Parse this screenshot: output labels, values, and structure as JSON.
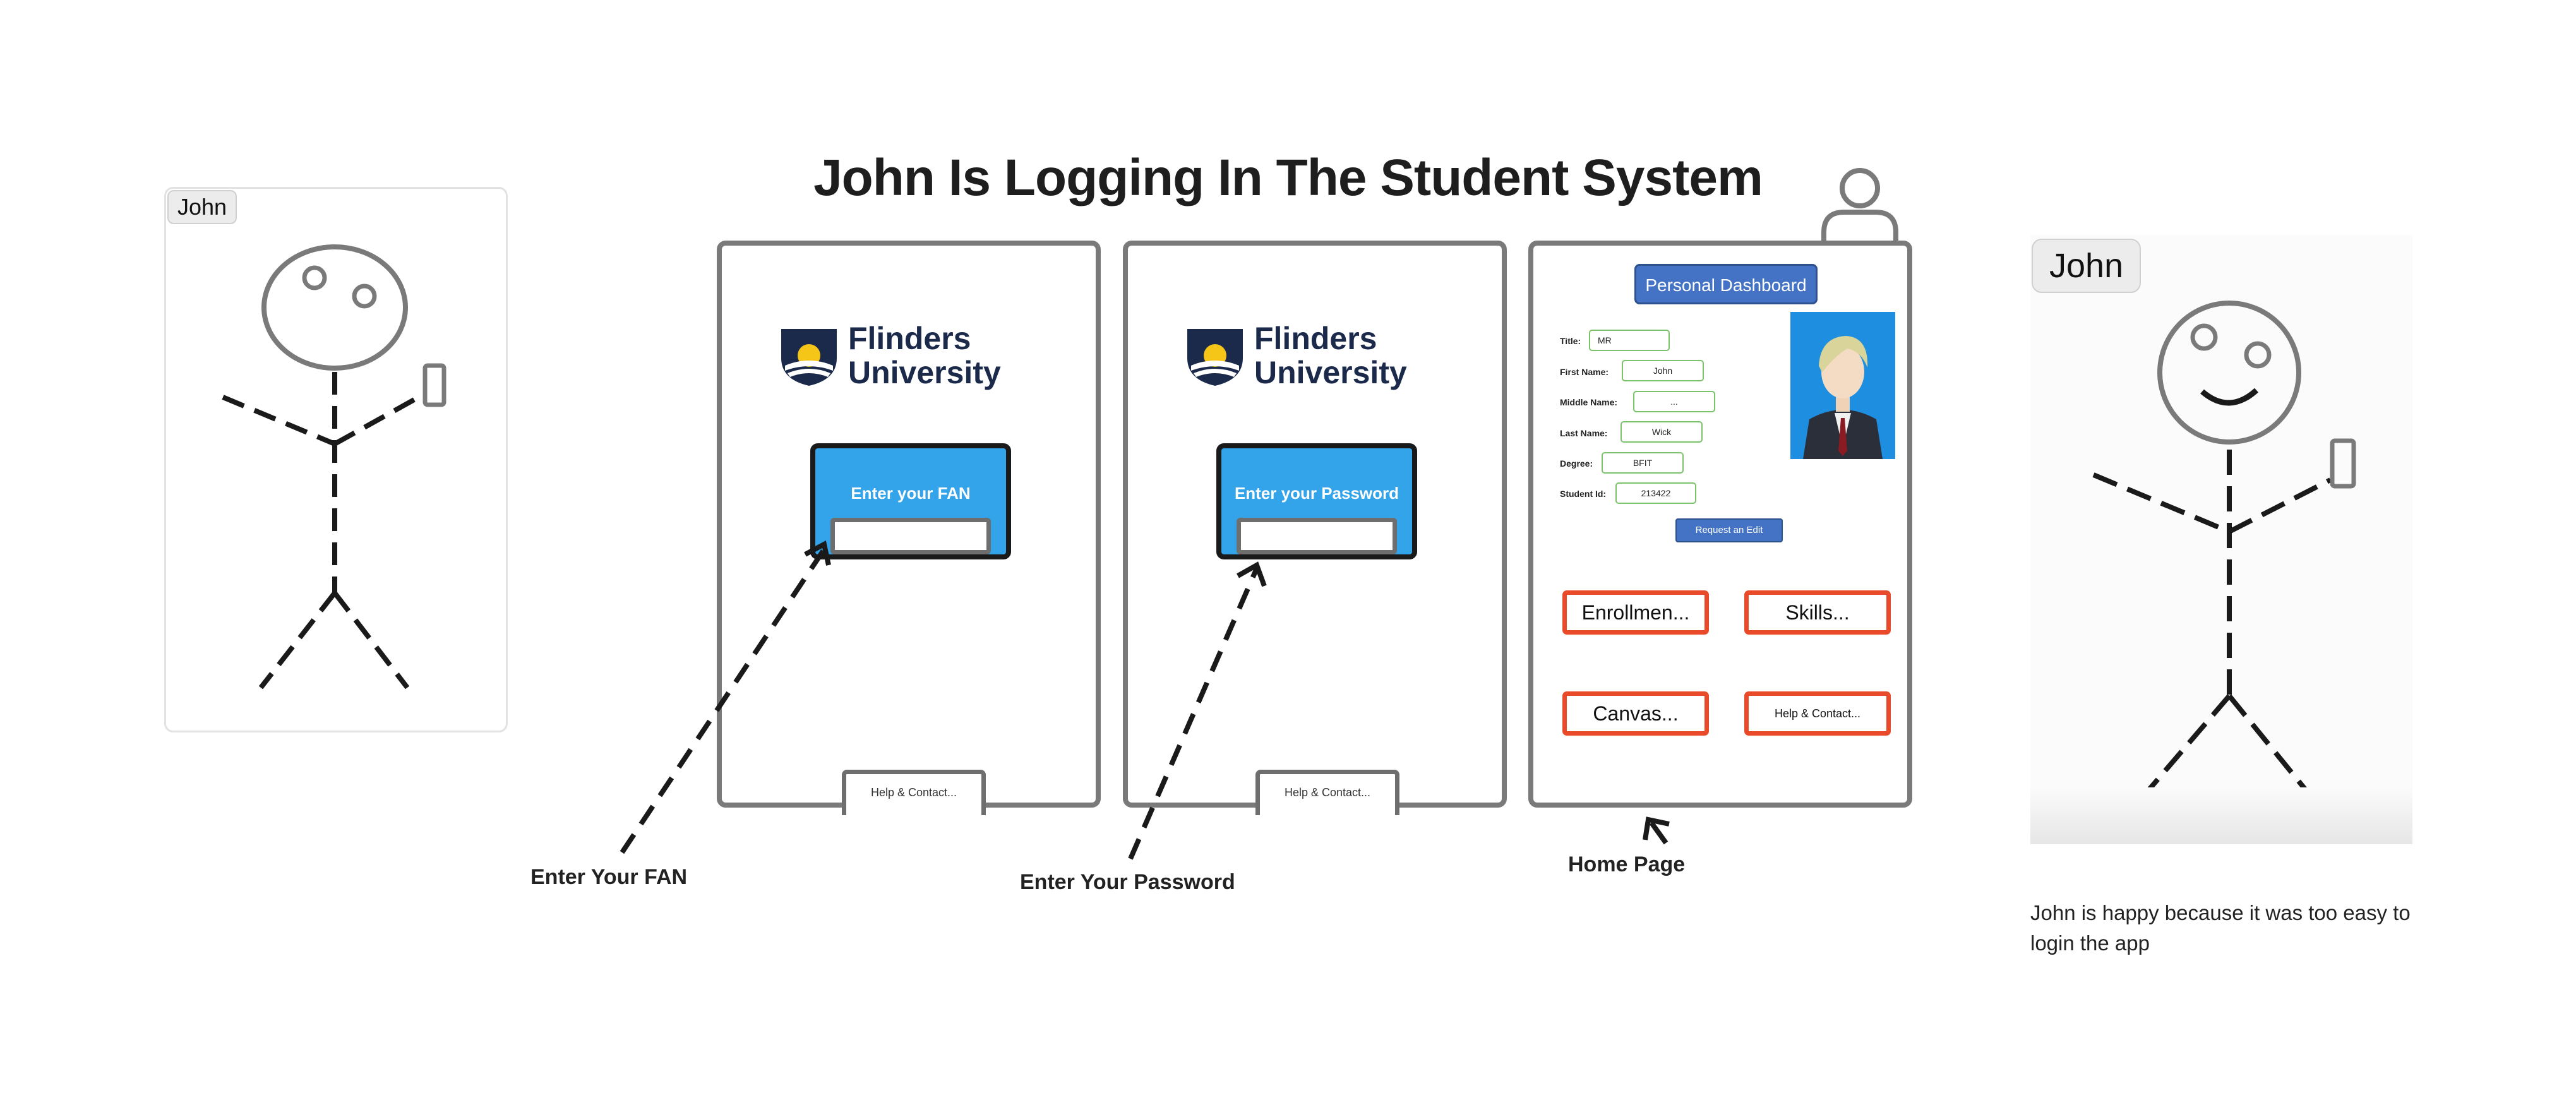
{
  "title": "John Is Logging In The Student System",
  "left_person": {
    "name": "John"
  },
  "right_person": {
    "name": "John",
    "caption": "John is happy because it was too easy to login the app"
  },
  "screens": {
    "fan": {
      "logo_line1": "Flinders",
      "logo_line2": "University",
      "prompt": "Enter your FAN",
      "help_label": "Help & Contact...",
      "caption": "Enter Your FAN"
    },
    "password": {
      "logo_line1": "Flinders",
      "logo_line2": "University",
      "prompt": "Enter your Password",
      "help_label": "Help & Contact...",
      "caption": "Enter Your Password"
    },
    "dashboard": {
      "header": "Personal Dashboard",
      "fields": [
        {
          "label": "Title:",
          "value": "MR"
        },
        {
          "label": "First Name:",
          "value": "John"
        },
        {
          "label": "Middle Name:",
          "value": "..."
        },
        {
          "label": "Last Name:",
          "value": "Wick"
        },
        {
          "label": "Degree:",
          "value": "BFIT"
        },
        {
          "label": "Student Id:",
          "value": "213422"
        }
      ],
      "request_edit": "Request an Edit",
      "buttons": [
        "Enrollmen...",
        "Skills...",
        "Canvas...",
        "Help & Contact..."
      ],
      "caption": "Home Page"
    }
  },
  "colors": {
    "frame_border": "#7a7a7a",
    "login_blue": "#33a3ea",
    "dashboard_blue": "#4472c4",
    "nav_border": "#e94a2a",
    "field_border": "#7ac36a"
  }
}
